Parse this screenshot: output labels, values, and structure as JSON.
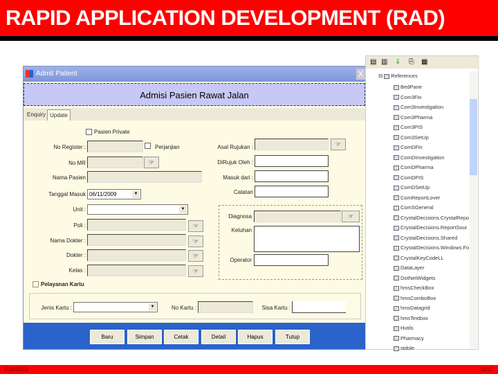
{
  "slide": {
    "title": "RAPID APPLICATION DEVELOPMENT (RAD)",
    "date": "3/18/2018",
    "page": "11/17"
  },
  "window": {
    "title": "Admit Patient",
    "close": "X",
    "header": "Admisi Pasien Rawat Jalan",
    "tabs": [
      "Enquiry",
      "Update"
    ],
    "pasien_private": "Pasien Private",
    "perjanjian": "Perjanjian",
    "labels": {
      "no_register": "No Register :",
      "no_mr": "No MR",
      "nama_pasien": "Nama Pasien",
      "tanggal_masuk": "Tanggal Masuk",
      "unit": "Unit :",
      "poli": "Poli :",
      "nama_dokter": "Nama Dokter :",
      "dokter": "Dokter :",
      "kelas": "Kelas :",
      "asal_rujukan": "Asal Rujukan :",
      "dirujuk_oleh": "DiRujuk Oleh :",
      "masuk_dari": "Masuk dari :",
      "catatan": "Catatan",
      "diagnosa": "Diagnosa",
      "keluhan": "Keluhan",
      "operator": "Operator",
      "jenis_kartu": "Jenis Kartu :",
      "no_kartu": "No Kartu :",
      "sisa_kartu": "Sisa Kartu :"
    },
    "tanggal_value": "06/11/2009",
    "pelayanan_kartu": "Pelayanan Kartu",
    "lookup_icon": "☞",
    "buttons": [
      "Baru",
      "Simpan",
      "Cetak",
      "Detail",
      "Hapus",
      "Tutup"
    ]
  },
  "tree": {
    "root": "References",
    "items": [
      "BedPane",
      "Com3Fin",
      "Com3Investigation",
      "Com3Pharma",
      "Com3PIS",
      "Com3SetUp",
      "ComDFin",
      "ComDInvestigation",
      "ComDPharma",
      "ComDPIS",
      "ComDSetUp",
      "ComReportLover",
      "ComSGeneral",
      "CrystalDecisions.CrystalRepo",
      "CrystalDecisions.ReportSour",
      "CrystalDecisions.Shared",
      "CrystalDecisions.Windows.Fo",
      "CrystalKeyCodeLL",
      "DataLayer",
      "DotNetWidgets",
      "hmsCheckBox",
      "hmsComboBox",
      "hmsDatagrid",
      "hmsTextbox",
      "Hutils",
      "Pharmacy",
      "stdole"
    ]
  }
}
